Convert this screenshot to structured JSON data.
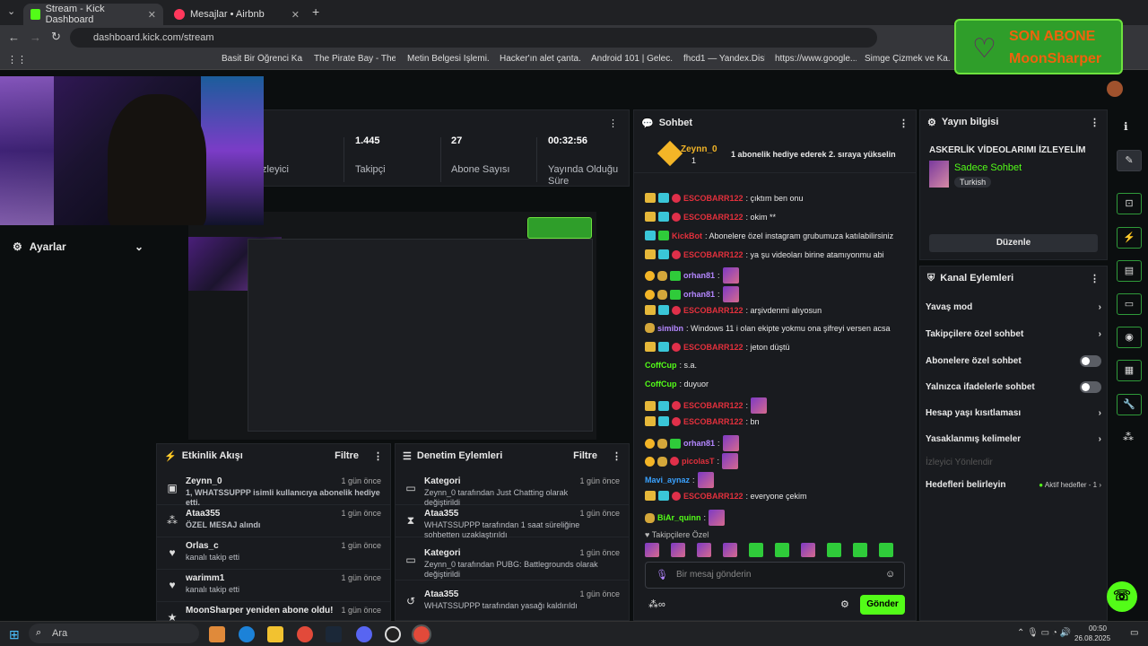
{
  "browser": {
    "tabs": [
      {
        "title": "Stream - Kick Dashboard",
        "active": true
      },
      {
        "title": "Mesajlar • Airbnb",
        "active": false
      }
    ],
    "url": "dashboard.kick.com/stream",
    "bookmarks": [
      "Basit Bir Öğrenci Ka...",
      "The Pirate Bay - The...",
      "Metin Belgesi İşlemi...",
      "Hacker'ın alet çanta...",
      "Android 101 | Gelec...",
      "fhcd1 — Yandex.Disk",
      "https://www.google...",
      "Simge Çizmek ve Ka..."
    ]
  },
  "overlay": {
    "line1": "SON ABONE",
    "line2": "MoonSharper"
  },
  "stats": [
    {
      "value": "",
      "label": "İzleyici"
    },
    {
      "value": "1.445",
      "label": "Takipçi"
    },
    {
      "value": "27",
      "label": "Abone Sayısı"
    },
    {
      "value": "00:32:56",
      "label": "Yayında Olduğu Süre"
    }
  ],
  "sidebar": {
    "settings_label": "Ayarlar"
  },
  "activity": {
    "title": "Etkinlik Akışı",
    "filter": "Filtre",
    "items": [
      {
        "icon": "gift-icon",
        "name": "Zeynn_0",
        "desc": "1, WHATSSUPPP isimli kullanıcıya abonelik hediye etti.",
        "time": "1 gün önce"
      },
      {
        "icon": "kicks-icon",
        "name": "Ataa355",
        "desc": "ÖZEL MESAJ alındı",
        "time": "1 gün önce"
      },
      {
        "icon": "heart-icon",
        "name": "Orlas_c",
        "desc": "kanalı takip etti",
        "time": "1 gün önce"
      },
      {
        "icon": "heart-icon",
        "name": "warimm1",
        "desc": "kanalı takip etti",
        "time": "1 gün önce"
      },
      {
        "icon": "star-icon",
        "name": "MoonSharper yeniden abone oldu!",
        "desc": "",
        "time": "1 gün önce"
      }
    ]
  },
  "moderation": {
    "title": "Denetim Eylemleri",
    "filter": "Filtre",
    "items": [
      {
        "icon": "category-icon",
        "name": "Kategori",
        "line1": "Zeynn_0 tarafından Just Chatting olarak değiştirildi",
        "time": "1 gün önce"
      },
      {
        "icon": "timeout-icon",
        "name": "Ataa355",
        "line1": "WHATSSUPPP tarafından 1 saat süreliğine sohbetten uzaklaştırıldı",
        "time": "1 gün önce"
      },
      {
        "icon": "category-icon",
        "name": "Kategori",
        "line1": "Zeynn_0 tarafından PUBG: Battlegrounds olarak değiştirildi",
        "time": "1 gün önce"
      },
      {
        "icon": "unban-icon",
        "name": "Ataa355",
        "line1": "WHATSSUPPP tarafından yasağı kaldırıldı",
        "time": "1 gün önce"
      }
    ]
  },
  "chat": {
    "title": "Sohbet",
    "pinned": {
      "user": "Zeynn_0",
      "count": "1",
      "text": "1 abonelik hediye ederek 2. sıraya yükselin"
    },
    "messages": [
      {
        "user": "ESCOBARR122",
        "color": "red",
        "text": ": çıktım ben onu"
      },
      {
        "user": "ESCOBARR122",
        "color": "red",
        "text": ": okim **"
      },
      {
        "user": "KickBot",
        "color": "red",
        "text": ": Abonelere özel instagram grubumuza katılabilirsiniz"
      },
      {
        "user": "ESCOBARR122",
        "color": "red",
        "text": ": ya şu videoları birine atamıyonmu abi"
      },
      {
        "user": "orhan81",
        "color": "pur",
        "text": ":"
      },
      {
        "user": "orhan81",
        "color": "pur",
        "text": ":"
      },
      {
        "user": "ESCOBARR122",
        "color": "red",
        "text": ": arşivdenmi alıyosun"
      },
      {
        "user": "simibn",
        "color": "pur",
        "text": ": Windows 11 i olan ekipte yokmu ona şifreyi versen acsa"
      },
      {
        "user": "ESCOBARR122",
        "color": "red",
        "text": ": jeton düştü"
      },
      {
        "user": "CoffCup",
        "color": "grn",
        "text": ": s.a."
      },
      {
        "user": "CoffCup",
        "color": "grn",
        "text": ": duyuor"
      },
      {
        "user": "ESCOBARR122",
        "color": "red",
        "text": ":"
      },
      {
        "user": "ESCOBARR122",
        "color": "red",
        "text": ": bn"
      },
      {
        "user": "orhan81",
        "color": "pur",
        "text": ":"
      },
      {
        "user": "picolasT",
        "color": "red",
        "text": ":"
      },
      {
        "user": "Mavi_aynaz",
        "color": "blu",
        "text": ":"
      },
      {
        "user": "ESCOBARR122",
        "color": "red",
        "text": ": everyone çekim"
      },
      {
        "user": "BiAr_quinn",
        "color": "grn",
        "text": ":"
      }
    ],
    "followers_only": "Takipçilere Özel",
    "input_placeholder": "Bir mesaj gönderin",
    "send": "Gönder"
  },
  "stream_info": {
    "title": "Yayın bilgisi",
    "stream_title": "ASKERLİK VİDEOLARIMI İZLEYELİM",
    "category": "Sadece Sohbet",
    "language": "Turkish",
    "edit": "Düzenle"
  },
  "channel_actions": {
    "title": "Kanal Eylemleri",
    "rows": [
      {
        "label": "Yavaş mod",
        "type": "arrow"
      },
      {
        "label": "Takipçilere özel sohbet",
        "type": "arrow"
      },
      {
        "label": "Abonelere özel sohbet",
        "type": "toggle"
      },
      {
        "label": "Yalnızca ifadelerle sohbet",
        "type": "toggle"
      },
      {
        "label": "Hesap yaşı kısıtlaması",
        "type": "arrow"
      },
      {
        "label": "Yasaklanmış kelimeler",
        "type": "arrow"
      }
    ],
    "viewer_redirect": "İzleyici Yönlendir",
    "targets": "Hedefleri belirleyin",
    "targets_status": "Aktif hedefler - 1"
  },
  "taskbar": {
    "search": "Ara",
    "time": "00:50",
    "date": "26.08.2025"
  }
}
